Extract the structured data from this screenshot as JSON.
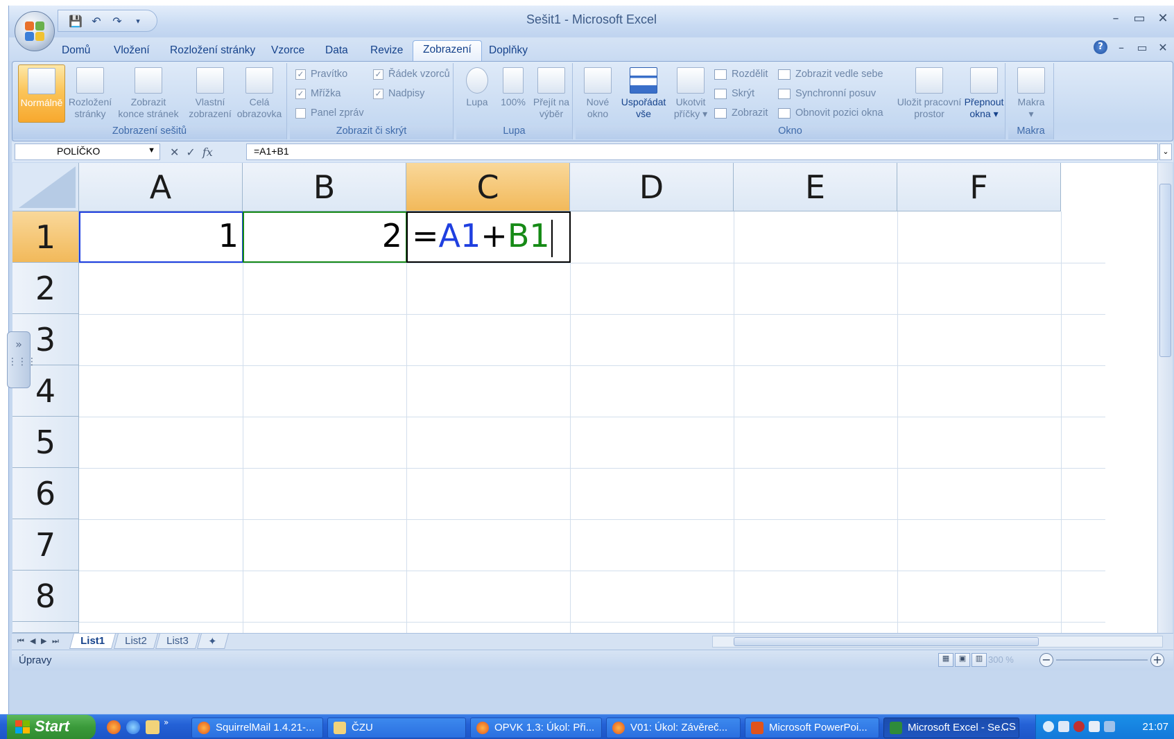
{
  "window": {
    "title": "Sešit1 - Microsoft Excel",
    "controls": [
      "–",
      "▭",
      "✕"
    ],
    "workbook_controls": [
      "?",
      "–",
      "▭",
      "✕"
    ]
  },
  "ribbon": {
    "tabs": [
      "Domů",
      "Vložení",
      "Rozložení stránky",
      "Vzorce",
      "Data",
      "Revize",
      "Zobrazení",
      "Doplňky"
    ],
    "active_tab": "Zobrazení",
    "groups": {
      "workbook_views": {
        "label": "Zobrazení sešitů",
        "buttons": [
          {
            "line1": "Normálně",
            "line2": ""
          },
          {
            "line1": "Rozložení",
            "line2": "stránky"
          },
          {
            "line1": "Zobrazit",
            "line2": "konce stránek"
          },
          {
            "line1": "Vlastní",
            "line2": "zobrazení"
          },
          {
            "line1": "Celá",
            "line2": "obrazovka"
          }
        ]
      },
      "show_hide": {
        "label": "Zobrazit či skrýt",
        "items": [
          {
            "label": "Pravítko",
            "checked": true
          },
          {
            "label": "Řádek vzorců",
            "checked": true
          },
          {
            "label": "Mřížka",
            "checked": true
          },
          {
            "label": "Nadpisy",
            "checked": true
          },
          {
            "label": "Panel zpráv",
            "checked": false
          }
        ]
      },
      "zoom": {
        "label": "Lupa",
        "buttons": [
          {
            "line1": "Lupa",
            "line2": ""
          },
          {
            "line1": "100%",
            "line2": ""
          },
          {
            "line1": "Přejít na",
            "line2": "výběr"
          }
        ]
      },
      "window": {
        "label": "Okno",
        "buttons": [
          {
            "line1": "Nové",
            "line2": "okno"
          },
          {
            "line1": "Uspořádat",
            "line2": "vše"
          },
          {
            "line1": "Ukotvit",
            "line2": "příčky ▾"
          }
        ],
        "small": [
          "Rozdělit",
          "Skrýt",
          "Zobrazit",
          "Zobrazit vedle sebe",
          "Synchronní posuv",
          "Obnovit pozici okna"
        ],
        "save_workspace": {
          "line1": "Uložit pracovní",
          "line2": "prostor"
        },
        "switch_windows": {
          "line1": "Přepnout",
          "line2": "okna ▾"
        }
      },
      "macros": {
        "label": "Makra",
        "button": {
          "line1": "Makra",
          "line2": "▾"
        }
      }
    }
  },
  "formula_bar": {
    "name_box": "POLÍČKO",
    "formula": "=A1+B1",
    "icons": [
      "cancel-icon",
      "enter-icon",
      "function-icon"
    ]
  },
  "sheet": {
    "columns": [
      "A",
      "B",
      "C",
      "D",
      "E",
      "F"
    ],
    "rows": [
      "1",
      "2",
      "3",
      "4",
      "5",
      "6",
      "7",
      "8"
    ],
    "selected_column": "C",
    "selected_row": "1",
    "cells": {
      "A1": "1",
      "B1": "2",
      "C1_eq": "=",
      "C1_ref1": "A1",
      "C1_plus": "+",
      "C1_ref2": "B1"
    },
    "colors": {
      "ref1": "#1f3fe0",
      "ref2": "#168a16"
    }
  },
  "sheet_tabs": {
    "nav": [
      "⏮",
      "◀",
      "▶",
      "⏭"
    ],
    "tabs": [
      "List1",
      "List2",
      "List3"
    ],
    "active": "List1"
  },
  "status_bar": {
    "mode": "Úpravy",
    "zoom": "300 %"
  },
  "taskbar": {
    "start": "Start",
    "buttons": [
      {
        "label": "SquirrelMail 1.4.21-...",
        "active": false
      },
      {
        "label": "ČZU",
        "active": false
      },
      {
        "label": "OPVK 1.3: Úkol: Při...",
        "active": false
      },
      {
        "label": "V01: Úkol: Závěreč...",
        "active": false
      },
      {
        "label": "Microsoft PowerPoi...",
        "active": false
      },
      {
        "label": "Microsoft Excel - Se...",
        "active": true
      }
    ],
    "language": "CS",
    "clock": "21:07"
  }
}
